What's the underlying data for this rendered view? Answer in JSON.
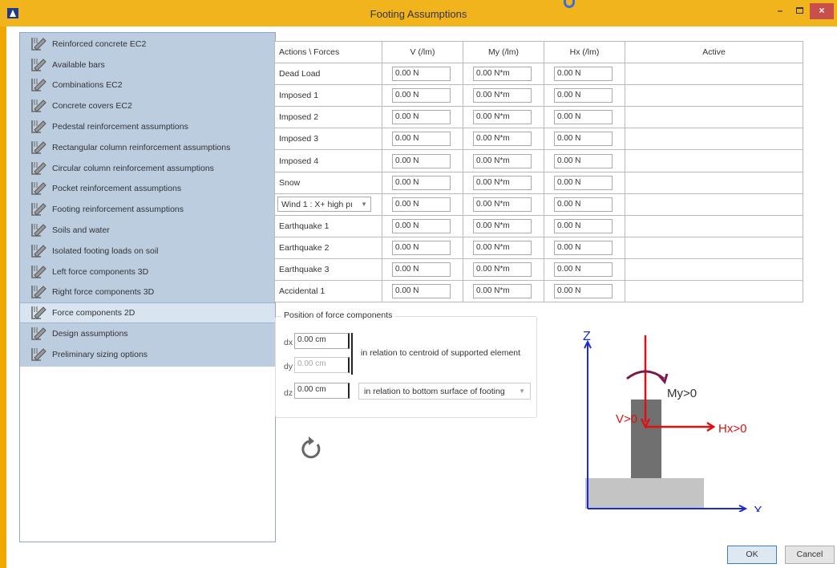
{
  "window": {
    "title": "Footing Assumptions",
    "minimize": "–",
    "close": "×"
  },
  "tree": {
    "items": [
      {
        "label": "Reinforced concrete EC2"
      },
      {
        "label": "Available bars"
      },
      {
        "label": "Combinations EC2"
      },
      {
        "label": "Concrete covers EC2"
      },
      {
        "label": "Pedestal reinforcement assumptions"
      },
      {
        "label": "Rectangular column reinforcement assumptions"
      },
      {
        "label": "Circular column reinforcement assumptions"
      },
      {
        "label": "Pocket reinforcement assumptions"
      },
      {
        "label": "Footing reinforcement assumptions"
      },
      {
        "label": "Soils and water"
      },
      {
        "label": "Isolated footing loads on soil"
      },
      {
        "label": "Left force components 3D"
      },
      {
        "label": "Right force components 3D"
      },
      {
        "label": "Force components 2D"
      },
      {
        "label": "Design assumptions"
      },
      {
        "label": "Preliminary sizing options"
      }
    ],
    "selected": "Force components 2D"
  },
  "grid": {
    "headers": [
      "Actions \\ Forces",
      "V (/lm)",
      "My (/lm)",
      "Hx (/lm)",
      "Active"
    ],
    "rows": [
      {
        "action": "Dead Load",
        "v": "0.00 N",
        "my": "0.00 N*m",
        "hx": "0.00 N"
      },
      {
        "action": "Imposed 1",
        "v": "0.00 N",
        "my": "0.00 N*m",
        "hx": "0.00 N"
      },
      {
        "action": "Imposed 2",
        "v": "0.00 N",
        "my": "0.00 N*m",
        "hx": "0.00 N"
      },
      {
        "action": "Imposed 3",
        "v": "0.00 N",
        "my": "0.00 N*m",
        "hx": "0.00 N"
      },
      {
        "action": "Imposed 4",
        "v": "0.00 N",
        "my": "0.00 N*m",
        "hx": "0.00 N"
      },
      {
        "action": "Snow",
        "v": "0.00 N",
        "my": "0.00 N*m",
        "hx": "0.00 N"
      },
      {
        "action": "Wind 1 : X+ high pı",
        "v": "0.00 N",
        "my": "0.00 N*m",
        "hx": "0.00 N"
      },
      {
        "action": "Earthquake 1",
        "v": "0.00 N",
        "my": "0.00 N*m",
        "hx": "0.00 N"
      },
      {
        "action": "Earthquake 2",
        "v": "0.00 N",
        "my": "0.00 N*m",
        "hx": "0.00 N"
      },
      {
        "action": "Earthquake 3",
        "v": "0.00 N",
        "my": "0.00 N*m",
        "hx": "0.00 N"
      },
      {
        "action": "Accidental 1",
        "v": "0.00 N",
        "my": "0.00 N*m",
        "hx": "0.00 N"
      }
    ]
  },
  "position": {
    "title": "Position of force components",
    "dx_label": "dx",
    "dx_value": "0.00 cm",
    "dy_label": "dy",
    "dy_value": "0.00 cm",
    "dxdy_relation": "in relation to centroid of supported element",
    "dz_label": "dz",
    "dz_value": "0.00 cm",
    "dz_relation": "in relation to bottom surface of footing"
  },
  "diagram": {
    "z_label": "Z",
    "x_label": "X",
    "my_label": "My>0",
    "v_label": "V>0",
    "hx_label": "Hx>0",
    "colors": {
      "axis": "#1a2ad8",
      "force": "#e01010",
      "moment": "#7a1a4a",
      "column": "#707070",
      "footing": "#c4c4c4"
    }
  },
  "buttons": {
    "ok": "OK",
    "cancel": "Cancel"
  }
}
